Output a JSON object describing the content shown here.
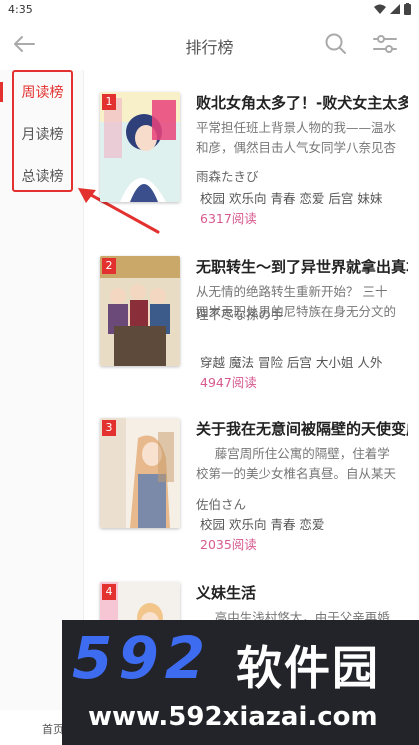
{
  "status_bar": {
    "time": "4:35"
  },
  "header": {
    "title": "排行榜"
  },
  "sidebar": {
    "items": [
      {
        "label": "周读榜",
        "active": true
      },
      {
        "label": "月读榜",
        "active": false
      },
      {
        "label": "总读榜",
        "active": false
      }
    ]
  },
  "books": [
    {
      "rank": "1",
      "title": "败北女角太多了！-败犬女主太多了！",
      "description": "平常担任班上背景人物的我——温水和彦，偶然目击人气女同学八奈见杏菜被甩的场面",
      "author": "雨森たきび",
      "tags": "校园 欢乐向 青春 恋爱 后宫 妹妹",
      "reads": "6317阅读"
    },
    {
      "rank": "2",
      "title": "无职转生～到了异世界就拿出真本事～",
      "description": "从无情的绝路转生重新开始？ 三十四岁无职处男的尼特族在身无分文的状态下被赶出家门，",
      "author": "理不尽な孫の手",
      "tags": "穿越 魔法 冒险 后宫 大小姐 人外",
      "reads": "4947阅读"
    },
    {
      "rank": "3",
      "title": "关于我在无意间被隔壁的天使变成废柴这件事",
      "description": "藤宫周所住公寓的隔壁，住着学校第一的美少女椎名真昼。自从某天起",
      "author": "佐伯さん",
      "tags": "校园 欢乐向 青春 恋爱",
      "reads": "2035阅读"
    },
    {
      "rank": "4",
      "title": "义妹生活",
      "description": "高中生浅村悠太，由于父亲再婚",
      "author": "",
      "tags": "",
      "reads": ""
    }
  ],
  "bottom_nav": {
    "home_label": "首页"
  },
  "watermark": {
    "logo": "592",
    "brand": "软件园",
    "url": "www.592xiazai.com"
  },
  "colors": {
    "accent": "#e2312e",
    "reads": "#d65a8f",
    "watermark_blue": "#3d6cf0"
  }
}
